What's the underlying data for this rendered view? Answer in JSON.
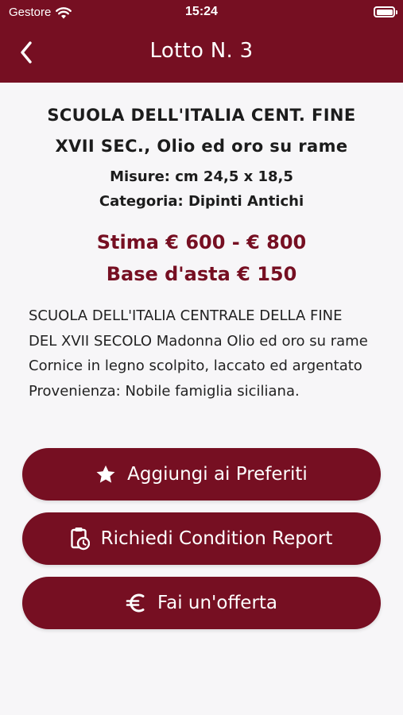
{
  "status_bar": {
    "carrier": "Gestore",
    "time": "15:24"
  },
  "nav": {
    "title": "Lotto N. 3"
  },
  "lot": {
    "title": "SCUOLA DELL'ITALIA CENT. FINE XVII SEC., Olio ed oro su rame",
    "measures": "Misure: cm 24,5 x 18,5",
    "category": "Categoria: Dipinti Antichi",
    "estimate": "Stima € 600 - € 800",
    "base": "Base d'asta € 150",
    "description": "SCUOLA DELL'ITALIA CENTRALE DELLA FINE DEL XVII SECOLO Madonna Olio ed oro su rame Cornice in legno scolpito, laccato ed argentato Provenienza: Nobile famiglia siciliana."
  },
  "actions": {
    "favorites": "Aggiungi ai Preferiti",
    "condition_report": "Richiedi Condition Report",
    "offer": "Fai un'offerta"
  },
  "icons": {
    "back": "chevron-left-icon",
    "favorites": "star-icon",
    "condition_report": "clipboard-clock-icon",
    "offer": "euro-icon",
    "wifi": "wifi-icon",
    "battery": "battery-icon"
  },
  "colors": {
    "accent": "#760f22",
    "background": "#f7f6f8"
  }
}
